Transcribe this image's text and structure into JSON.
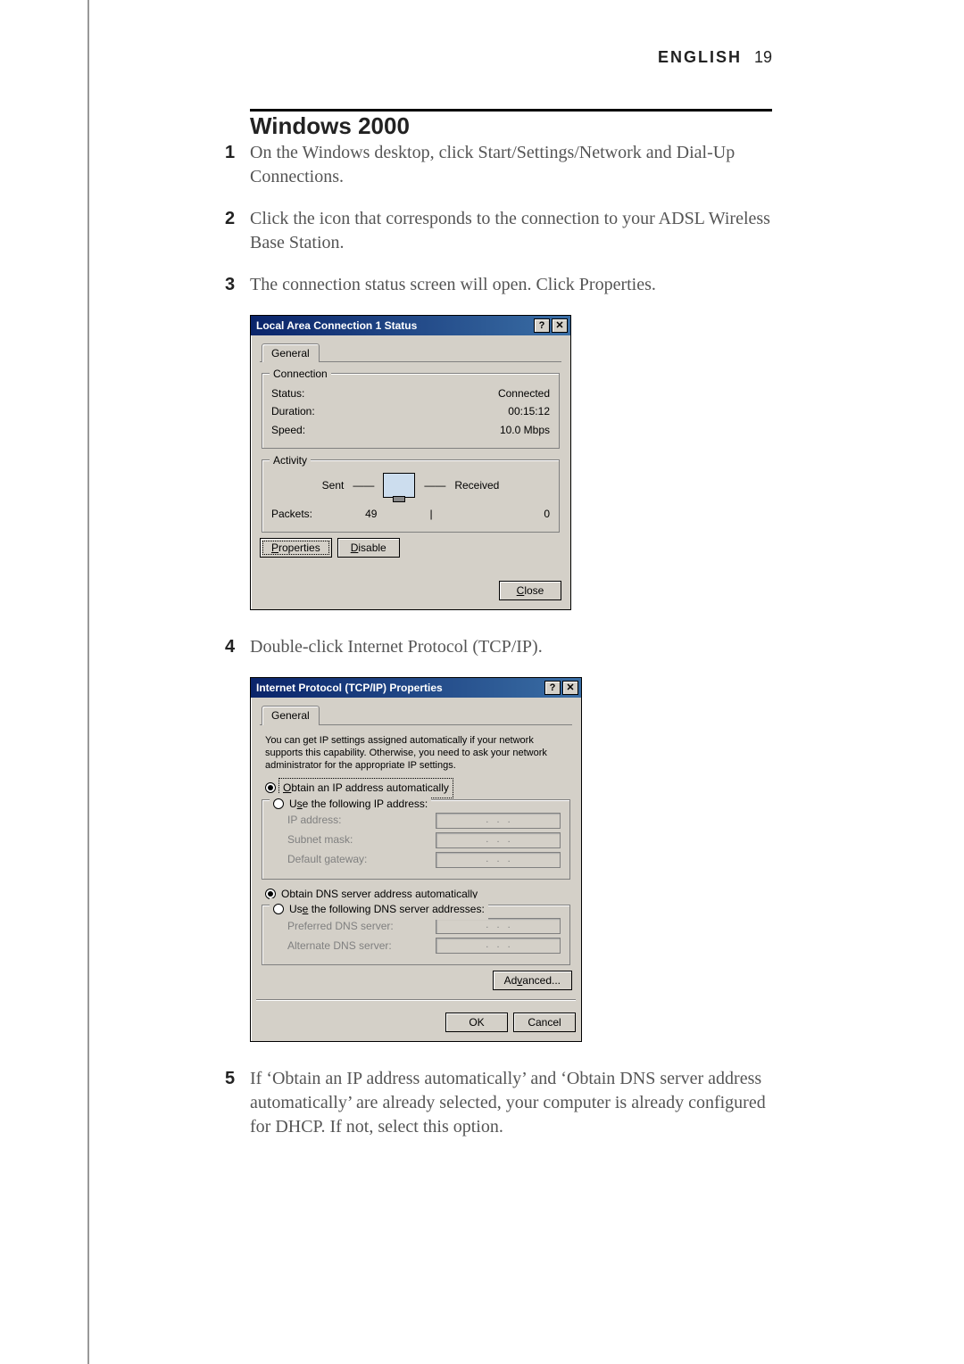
{
  "header": {
    "language": "ENGLISH",
    "page_number": "19"
  },
  "section_title": "Windows 2000",
  "steps": {
    "s1": {
      "num": "1",
      "text": "On the Windows desktop, click Start/Settings/Network and Dial-Up Connections."
    },
    "s2": {
      "num": "2",
      "text": "Click the icon that corresponds to the connection to your ADSL Wireless Base Station."
    },
    "s3": {
      "num": "3",
      "text": "The connection status screen will open. Click Properties."
    },
    "s4": {
      "num": "4",
      "text": "Double-click Internet Protocol (TCP/IP)."
    },
    "s5": {
      "num": "5",
      "text": "If ‘Obtain an IP address automatically’ and ‘Obtain DNS server address automatically’ are already selected, your computer is already configured for DHCP. If not, select this option."
    }
  },
  "dlg1": {
    "title": "Local Area Connection 1 Status",
    "tab_general": "General",
    "grp_connection": "Connection",
    "status_label": "Status:",
    "status_value": "Connected",
    "duration_label": "Duration:",
    "duration_value": "00:15:12",
    "speed_label": "Speed:",
    "speed_value": "10.0 Mbps",
    "grp_activity": "Activity",
    "sent_label": "Sent",
    "received_label": "Received",
    "packets_label": "Packets:",
    "sent_value": "49",
    "received_value": "0",
    "btn_properties": "Properties",
    "btn_disable": "Disable",
    "btn_close": "Close",
    "help_btn": "?",
    "close_x": "✕"
  },
  "dlg2": {
    "title": "Internet Protocol (TCP/IP) Properties",
    "tab_general": "General",
    "intro": "You can get IP settings assigned automatically if your network supports this capability. Otherwise, you need to ask your network administrator for the appropriate IP settings.",
    "r_obtain_ip": "Obtain an IP address automatically",
    "r_use_ip": "Use the following IP address:",
    "ip_label": "IP address:",
    "subnet_label": "Subnet mask:",
    "gateway_label": "Default gateway:",
    "r_obtain_dns": "Obtain DNS server address automatically",
    "r_use_dns": "Use the following DNS server addresses:",
    "pref_dns_label": "Preferred DNS server:",
    "alt_dns_label": "Alternate DNS server:",
    "btn_advanced": "Advanced...",
    "btn_ok": "OK",
    "btn_cancel": "Cancel",
    "help_btn": "?",
    "close_x": "✕"
  }
}
